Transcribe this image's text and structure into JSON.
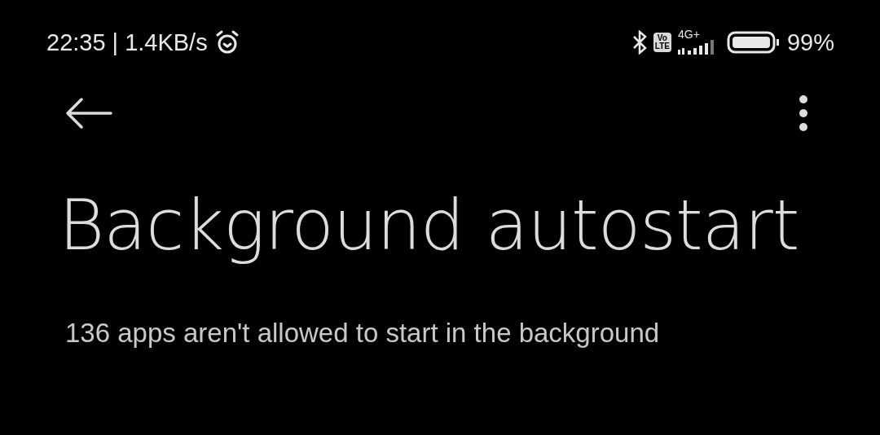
{
  "status_bar": {
    "time": "22:35",
    "separator": "|",
    "speed": "1.4KB/s",
    "volte": [
      "Vo",
      "LTE"
    ],
    "network": "4G+",
    "battery": "99%"
  },
  "header": {
    "title": "Background autostart"
  },
  "summary": "136 apps aren't allowed to start in the background"
}
